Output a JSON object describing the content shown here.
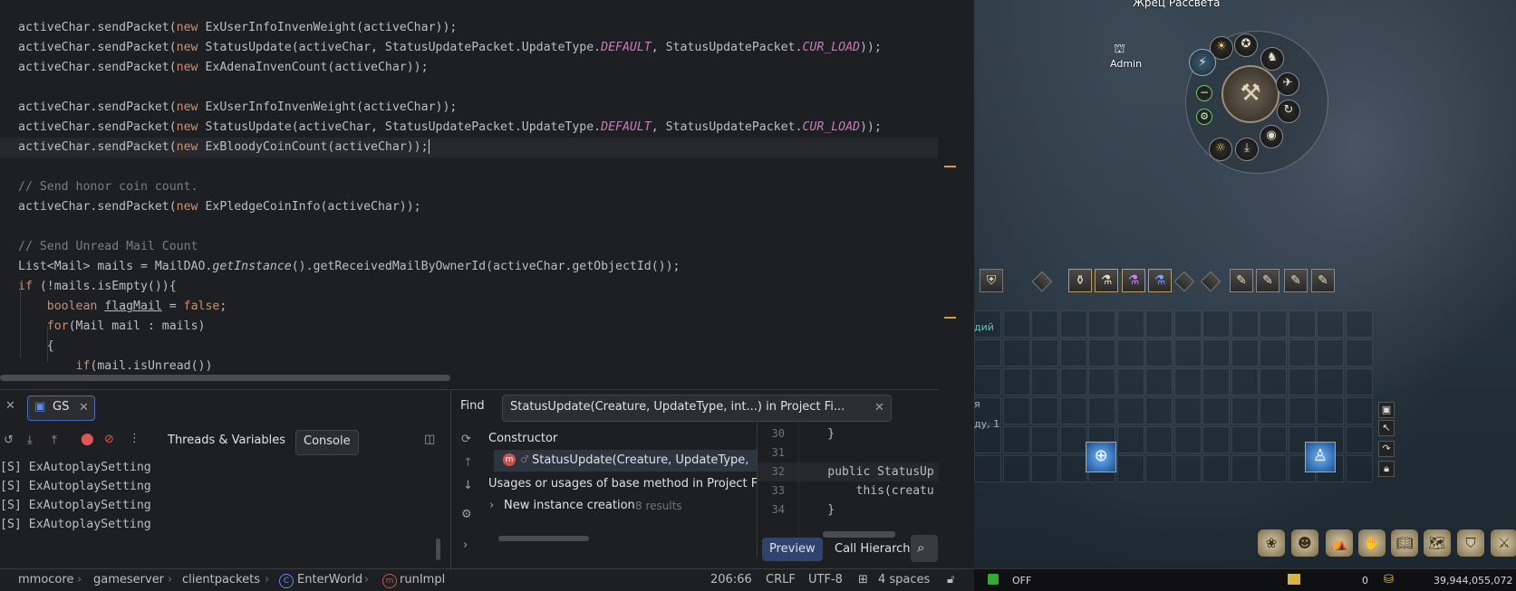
{
  "editor": {
    "lines": [
      {
        "parts": [
          [
            "",
            "activeChar.sendPacket("
          ],
          [
            "kw",
            "new "
          ],
          [
            "",
            "ExUserInfoInvenWeight(activeChar));"
          ]
        ]
      },
      {
        "parts": [
          [
            "",
            "activeChar.sendPacket("
          ],
          [
            "kw",
            "new "
          ],
          [
            "",
            "StatusUpdate(activeChar, StatusUpdatePacket.UpdateType."
          ],
          [
            "cst",
            "DEFAULT"
          ],
          [
            "",
            ", StatusUpdatePacket."
          ],
          [
            "cst",
            "CUR_LOAD"
          ],
          [
            "",
            "));"
          ]
        ]
      },
      {
        "parts": [
          [
            "",
            "activeChar.sendPacket("
          ],
          [
            "kw",
            "new "
          ],
          [
            "",
            "ExAdenaInvenCount(activeChar));"
          ]
        ]
      },
      {
        "parts": []
      },
      {
        "parts": [
          [
            "",
            "activeChar.sendPacket("
          ],
          [
            "kw",
            "new "
          ],
          [
            "",
            "ExUserInfoInvenWeight(activeChar));"
          ]
        ]
      },
      {
        "parts": [
          [
            "",
            "activeChar.sendPacket("
          ],
          [
            "kw",
            "new "
          ],
          [
            "",
            "StatusUpdate(activeChar, StatusUpdatePacket.UpdateType."
          ],
          [
            "cst",
            "DEFAULT"
          ],
          [
            "",
            ", StatusUpdatePacket."
          ],
          [
            "cst",
            "CUR_LOAD"
          ],
          [
            "",
            "));"
          ]
        ]
      },
      {
        "parts": [
          [
            "",
            "activeChar.sendPacket("
          ],
          [
            "kw",
            "new "
          ],
          [
            "",
            "ExBloodyCoinCount(activeChar));"
          ]
        ],
        "current": true
      },
      {
        "parts": []
      },
      {
        "parts": [
          [
            "cm",
            "// Send honor coin count."
          ]
        ]
      },
      {
        "parts": [
          [
            "",
            "activeChar.sendPacket("
          ],
          [
            "kw",
            "new "
          ],
          [
            "",
            "ExPledgeCoinInfo(activeChar));"
          ]
        ]
      },
      {
        "parts": []
      },
      {
        "parts": [
          [
            "cm",
            "// Send Unread Mail Count"
          ]
        ]
      },
      {
        "parts": [
          [
            "",
            "List<Mail> mails = MailDAO."
          ],
          [
            "it",
            "getInstance"
          ],
          [
            "",
            "().getReceivedMailByOwnerId(activeChar.getObjectId());"
          ]
        ]
      },
      {
        "parts": [
          [
            "kw",
            "if "
          ],
          [
            "",
            "(!mails.isEmpty()){"
          ]
        ]
      },
      {
        "parts": [
          [
            "",
            "    "
          ],
          [
            "kw",
            "boolean "
          ],
          [
            "ul",
            "flagMail"
          ],
          [
            "",
            " = "
          ],
          [
            "kw",
            "false"
          ],
          [
            "",
            ";"
          ]
        ]
      },
      {
        "parts": [
          [
            "",
            "    "
          ],
          [
            "kw",
            "for"
          ],
          [
            "",
            "(Mail mail : mails)"
          ]
        ]
      },
      {
        "parts": [
          [
            "",
            "    {"
          ]
        ]
      },
      {
        "parts": [
          [
            "",
            "        "
          ],
          [
            "kw",
            "if"
          ],
          [
            "",
            "(mail.isUnread())"
          ]
        ]
      }
    ]
  },
  "debug": {
    "run_tab": "GS",
    "threads_vars": "Threads & Variables",
    "console": "Console",
    "console_lines": [
      "[S] ExAutoplaySetting",
      "[S] ExAutoplaySetting",
      "[S] ExAutoplaySetting",
      "[S] ExAutoplaySetting"
    ]
  },
  "find": {
    "label": "Find",
    "query_tab": "StatusUpdate(Creature, UpdateType, int...) in Project Fi...",
    "constructor_header": "Constructor",
    "constructor_item": "StatusUpdate(Creature, UpdateType,",
    "usages_header": "Usages or usages of base method in Project Fi",
    "new_instance": "New instance creation",
    "results_count": "8 results",
    "preview_btn": "Preview",
    "call_hierarchy": "Call Hierarchy",
    "preview_lines": [
      {
        "num": "30",
        "code": "    }"
      },
      {
        "num": "31",
        "code": ""
      },
      {
        "num": "32",
        "code": "    public StatusUp"
      },
      {
        "num": "33",
        "code": "        this(creatu"
      },
      {
        "num": "34",
        "code": "    }"
      }
    ]
  },
  "status": {
    "breadcrumbs": [
      "mmocore",
      "gameserver",
      "clientpackets",
      "EnterWorld",
      "runImpl"
    ],
    "position": "206:66",
    "line_sep": "CRLF",
    "encoding": "UTF-8",
    "indent": "4 spaces"
  },
  "game": {
    "npc_name": "Жрец Рассвета",
    "player_name": "Admin",
    "partial_text_1": "дий",
    "partial_text_2": "я",
    "partial_text_3": "ду, 1",
    "off_label": "OFF",
    "zero_count": "0",
    "adena": "39,944,055,072"
  }
}
